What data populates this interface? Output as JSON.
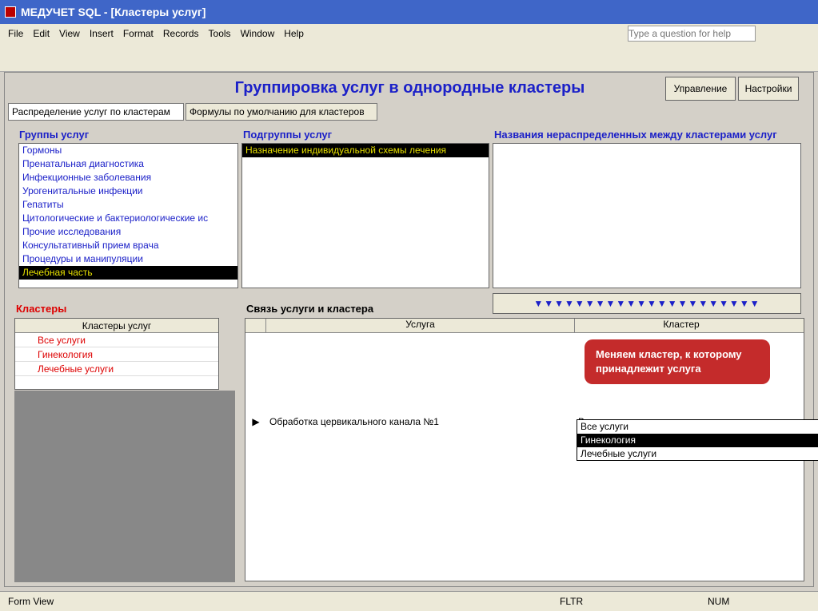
{
  "window": {
    "title": "МЕДУЧЕТ SQL - [Кластеры услуг]",
    "help_placeholder": "Type a question for help"
  },
  "menu": [
    "File",
    "Edit",
    "View",
    "Insert",
    "Format",
    "Records",
    "Tools",
    "Window",
    "Help"
  ],
  "form": {
    "heading": "Группировка услуг в однородные кластеры",
    "buttons": [
      "Управление",
      "Настройки"
    ],
    "tabs": [
      "Распределение услуг по кластерам",
      "Формулы по умолчанию для кластеров"
    ],
    "groups_label": "Группы услуг",
    "groups": [
      "Гормоны",
      "Пренатальная диагностика",
      "Инфекционные заболевания",
      "Урогенитальные инфекции",
      "Гепатиты",
      "Цитологические и бактериологические ис",
      "Прочие исследования",
      "Консультативный прием врача",
      "Процедуры и манипуляции",
      "Лечебная часть"
    ],
    "subgroups_label": "Подгруппы услуг",
    "subgroups": [
      "Назначение индивидуальной схемы лечения"
    ],
    "unassigned_label": "Названия нераспределенных между кластерами услуг",
    "clusters_label": "Кластеры",
    "clusters_header": "Кластеры услуг",
    "clusters": [
      "Все услуги",
      "Гинекология",
      "Лечебные услуги"
    ],
    "link_label": "Связь услуги и кластера",
    "col_service": "Услуга",
    "col_cluster": "Кластер",
    "current_row": {
      "service": "Обработка цервикального канала №1",
      "cluster": "Все услуги"
    },
    "dropdown": [
      "Все услуги",
      "Гинекология",
      "Лечебные услуги"
    ],
    "callout": "Меняем кластер, к которому принадлежит услуга"
  },
  "status": {
    "view": "Form View",
    "fltr": "FLTR",
    "num": "NUM"
  }
}
